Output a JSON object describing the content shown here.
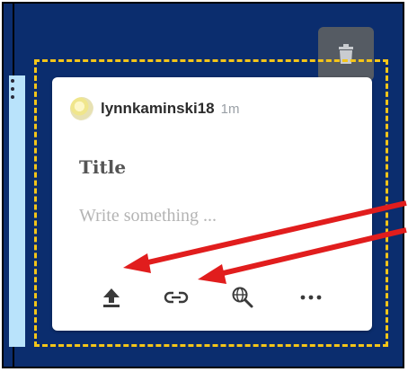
{
  "post": {
    "username": "lynnkaminski18",
    "time": "1m",
    "title_placeholder": "Title",
    "body_placeholder": "Write something ..."
  },
  "icons": {
    "trash": "trash-icon",
    "upload": "upload-icon",
    "link": "link-icon",
    "search": "globe-search-icon",
    "more": "more-horizontal-icon"
  },
  "colors": {
    "background": "#0b2d6e",
    "highlight_border": "#f5c518",
    "annotation_arrow": "#e11d1d",
    "side_panel": "#b9e3fb"
  }
}
